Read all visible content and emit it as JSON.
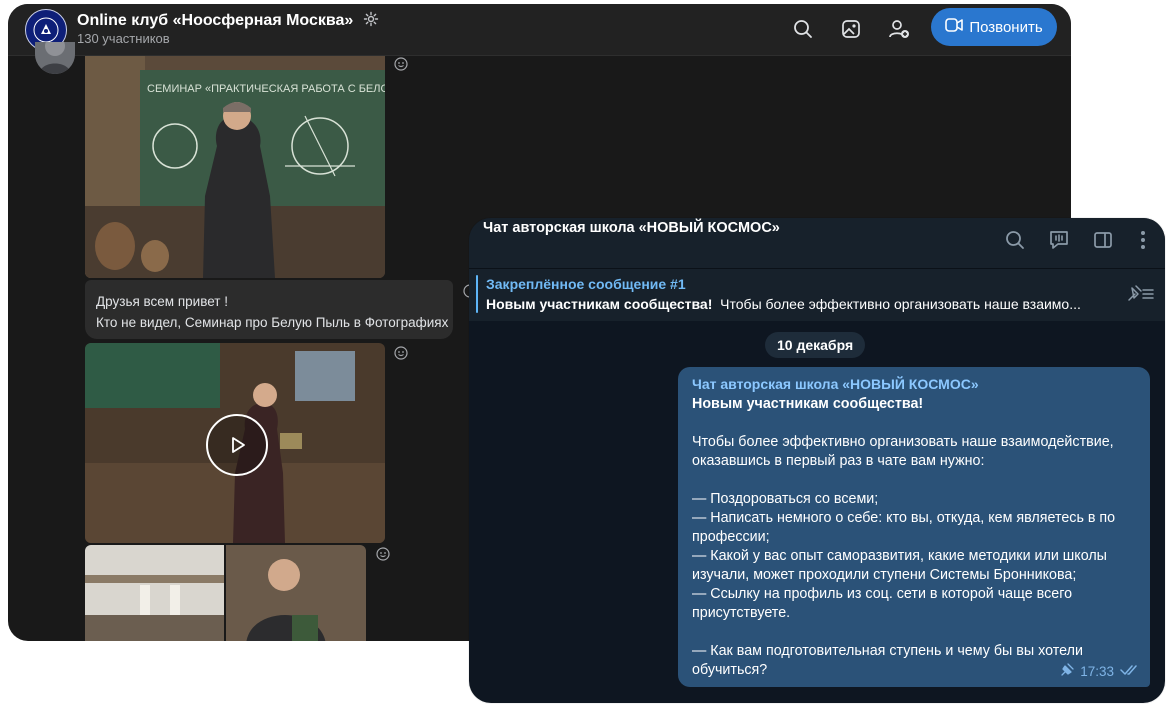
{
  "vk_window": {
    "title": "Online клуб «Ноосферная Москва»",
    "members": "130 участников",
    "call_label": "Позвонить",
    "caption_lines": [
      "Друзья всем привет !",
      "Кто не видел, Семинар про Белую Пыль в Фотографиях"
    ],
    "board_text": "СЕМИНАР «ПРАКТИЧЕСКАЯ РАБОТА С БЕЛОЙ ПЫЛЬЮ»"
  },
  "tg_window": {
    "chat_title": "Чат авторская школа «НОВЫЙ КОСМОС»",
    "pinned_title": "Закреплённое сообщение #1",
    "pinned_bold": "Новым участникам сообщества!",
    "pinned_text": "Чтобы более эффективно организовать наше взаимо...",
    "date_badge": "10 декабря",
    "message": {
      "author": "Чат авторская школа «НОВЫЙ КОСМОС»",
      "heading": "Новым участникам сообщества!",
      "para1": "Чтобы более эффективно организовать наше взаимодействие, оказавшись в первый раз в чате вам нужно:",
      "item1": "— Поздороваться со всеми;",
      "item2": "— Написать немного о себе: кто вы, откуда, кем являетесь в по профессии;",
      "item3": "— Какой у вас опыт саморазвития, какие методики или школы изучали, может проходили ступени Системы Бронникова;",
      "item4": "— Ссылку на профиль из соц. сети в которой чаще всего присутствуете.",
      "question": "— Как вам подготовительная ступень и чему бы вы хотели обучиться?",
      "time": "17:33"
    }
  },
  "colors": {
    "vk_bg": "#191919",
    "vk_call": "#2a77cf",
    "tg_bg": "#0e1621",
    "tg_bubble": "#2b5278",
    "tg_link": "#71baf5"
  },
  "icons": {
    "vk_header": [
      "search-icon",
      "gallery-icon",
      "add-user-icon",
      "video-call-icon"
    ],
    "tg_header": [
      "search-icon",
      "discussion-icon",
      "sidebar-icon",
      "more-icon"
    ],
    "reactions": [
      "smiley-icon"
    ]
  }
}
